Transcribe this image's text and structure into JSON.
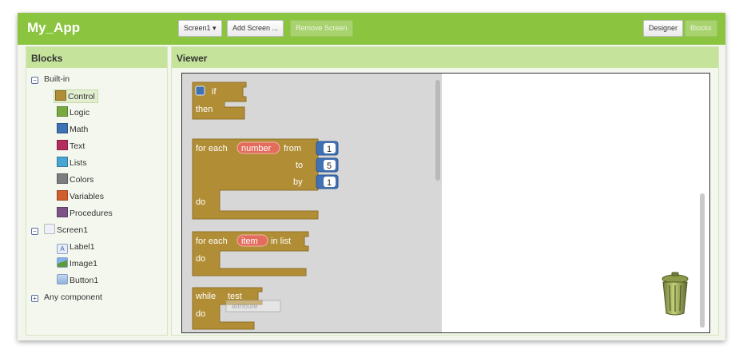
{
  "app": {
    "title": "My_App"
  },
  "toolbar": {
    "screen_dropdown": "Screen1 ▾",
    "add_screen": "Add Screen ...",
    "remove_screen": "Remove Screen",
    "designer": "Designer",
    "blocks": "Blocks"
  },
  "blocks_panel": {
    "header": "Blocks",
    "builtin_label": "Built-in",
    "builtin_items": [
      {
        "label": "Control",
        "color": "#b18e35"
      },
      {
        "label": "Logic",
        "color": "#77ab41"
      },
      {
        "label": "Math",
        "color": "#3f71b5"
      },
      {
        "label": "Text",
        "color": "#b32d5e"
      },
      {
        "label": "Lists",
        "color": "#49a6d4"
      },
      {
        "label": "Colors",
        "color": "#7d7d7d"
      },
      {
        "label": "Variables",
        "color": "#d05f2d"
      },
      {
        "label": "Procedures",
        "color": "#7c5385"
      }
    ],
    "selected_item": "Control",
    "screen_label": "Screen1",
    "components": [
      "Label1",
      "Image1",
      "Button1"
    ],
    "any_component": "Any component"
  },
  "viewer": {
    "header": "Viewer",
    "blocks": {
      "if_block": {
        "if": "if",
        "then": "then"
      },
      "for_range": {
        "for_each": "for each",
        "var": "number",
        "from": "from",
        "to": "to",
        "by": "by",
        "do": "do",
        "from_value": "1",
        "to_value": "5",
        "by_value": "1"
      },
      "for_list": {
        "for_each": "for each",
        "var": "item",
        "in_list": "in list",
        "do": "do"
      },
      "while_block": {
        "while": "while",
        "test": "test",
        "do": "do",
        "ghost": "attribute"
      }
    },
    "trash_icon": "trash-can-icon"
  },
  "colors": {
    "topbar": "#8bc43f",
    "panel_header": "#c5e39b",
    "control_block": "#b18e35",
    "math_block": "#3f71b5",
    "variable_pill": "#e46c5c"
  }
}
